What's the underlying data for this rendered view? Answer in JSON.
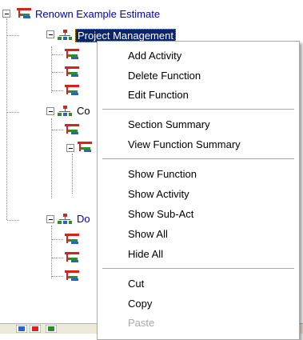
{
  "tree": {
    "root_label": "Renown Example Estimate",
    "nodes": [
      {
        "label": "Project Management"
      },
      {
        "label": "Co"
      },
      {
        "label": "Do"
      }
    ]
  },
  "menu": {
    "groups": [
      [
        "Add Activity",
        "Delete Function",
        "Edit Function"
      ],
      [
        "Section Summary",
        "View Function Summary"
      ],
      [
        "Show Function",
        "Show Activity",
        "Show Sub-Act",
        "Show All",
        "Hide All"
      ],
      [
        "Cut",
        "Copy",
        "Paste"
      ]
    ],
    "disabled": [
      "Paste"
    ]
  },
  "colors": {
    "accent_blue": "#0000cc",
    "selection": "#0a246a",
    "icon_red": "#d9221c",
    "icon_green": "#2e8b2e"
  },
  "icons": {
    "root": "estimate-tree-icon",
    "section": "hierarchy-icon",
    "activity": "activity-icon"
  }
}
